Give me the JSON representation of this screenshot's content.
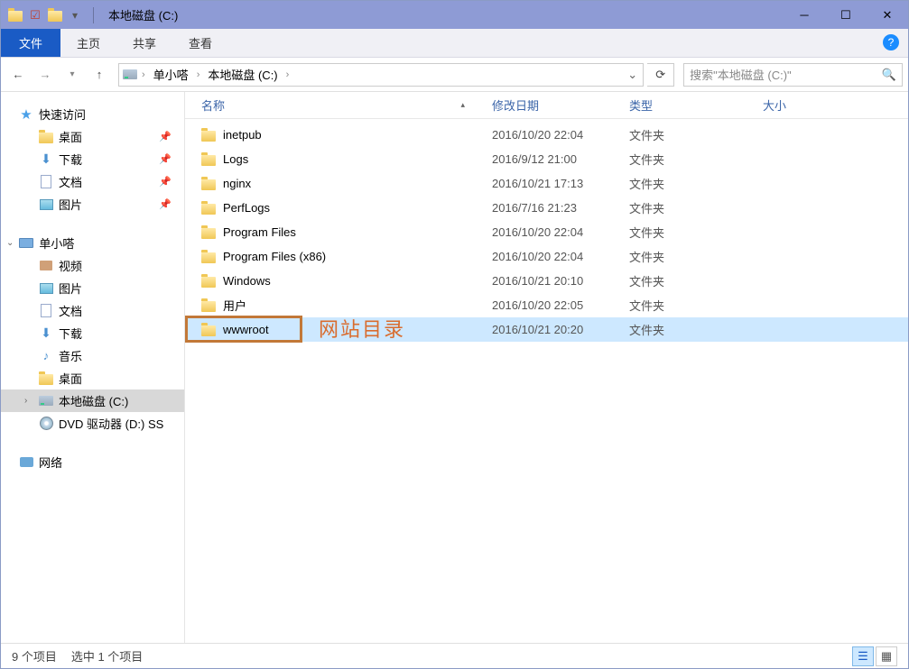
{
  "window": {
    "title": "本地磁盘 (C:)"
  },
  "ribbon": {
    "file": "文件",
    "tabs": [
      "主页",
      "共享",
      "查看"
    ]
  },
  "breadcrumb": {
    "items": [
      "单小嗒",
      "本地磁盘 (C:)"
    ]
  },
  "search": {
    "placeholder": "搜索\"本地磁盘 (C:)\""
  },
  "sidebar": {
    "quick": {
      "label": "快速访问",
      "items": [
        {
          "label": "桌面",
          "pinned": true,
          "ico": "folder"
        },
        {
          "label": "下载",
          "pinned": true,
          "ico": "dl"
        },
        {
          "label": "文档",
          "pinned": true,
          "ico": "doc"
        },
        {
          "label": "图片",
          "pinned": true,
          "ico": "pic"
        }
      ]
    },
    "pc": {
      "label": "单小嗒",
      "items": [
        {
          "label": "视频",
          "ico": "vid"
        },
        {
          "label": "图片",
          "ico": "pic"
        },
        {
          "label": "文档",
          "ico": "doc"
        },
        {
          "label": "下载",
          "ico": "dl"
        },
        {
          "label": "音乐",
          "ico": "music"
        },
        {
          "label": "桌面",
          "ico": "folder"
        },
        {
          "label": "本地磁盘 (C:)",
          "ico": "drive",
          "selected": true
        },
        {
          "label": "DVD 驱动器 (D:) SS",
          "ico": "dvd"
        }
      ]
    },
    "network": {
      "label": "网络"
    }
  },
  "columns": {
    "name": "名称",
    "date": "修改日期",
    "type": "类型",
    "size": "大小"
  },
  "files": [
    {
      "name": "inetpub",
      "date": "2016/10/20 22:04",
      "type": "文件夹"
    },
    {
      "name": "Logs",
      "date": "2016/9/12 21:00",
      "type": "文件夹"
    },
    {
      "name": "nginx",
      "date": "2016/10/21 17:13",
      "type": "文件夹"
    },
    {
      "name": "PerfLogs",
      "date": "2016/7/16 21:23",
      "type": "文件夹"
    },
    {
      "name": "Program Files",
      "date": "2016/10/20 22:04",
      "type": "文件夹"
    },
    {
      "name": "Program Files (x86)",
      "date": "2016/10/20 22:04",
      "type": "文件夹"
    },
    {
      "name": "Windows",
      "date": "2016/10/21 20:10",
      "type": "文件夹"
    },
    {
      "name": "用户",
      "date": "2016/10/20 22:05",
      "type": "文件夹"
    },
    {
      "name": "wwwroot",
      "date": "2016/10/21 20:20",
      "type": "文件夹",
      "selected": true
    }
  ],
  "annotation": {
    "label": "网站目录"
  },
  "status": {
    "count": "9 个项目",
    "selected": "选中 1 个项目"
  }
}
